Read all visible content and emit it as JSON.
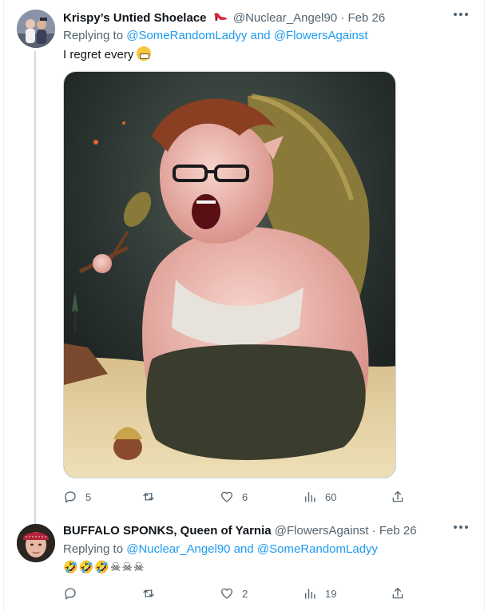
{
  "tweets": [
    {
      "display_name": "Krispy’s Untied Shoelace",
      "handle": "@Nuclear_Angel90",
      "date": "· Feb 26",
      "replying_label": "Replying to",
      "reply_user_1": "@SomeRandomLadyy",
      "reply_and": "and",
      "reply_user_2": "@FlowersAgainst",
      "text": "I regret every",
      "replies": "5",
      "retweets": "",
      "likes": "6",
      "views": "60"
    },
    {
      "display_name": "BUFFALO SPONKS, Queen of Yarnia",
      "handle": "@FlowersAgainst",
      "date": "· Feb 26",
      "replying_label": "Replying to",
      "reply_user_1": "@Nuclear_Angel90",
      "reply_and": "and",
      "reply_user_2": "@SomeRandomLadyy",
      "text": "🤣🤣🤣☠☠☠",
      "replies": "",
      "retweets": "",
      "likes": "2",
      "views": "19"
    }
  ],
  "colors": {
    "text": "#0f1419",
    "muted": "#536471",
    "link": "#1d9bf0",
    "border": "#cfd9de"
  }
}
